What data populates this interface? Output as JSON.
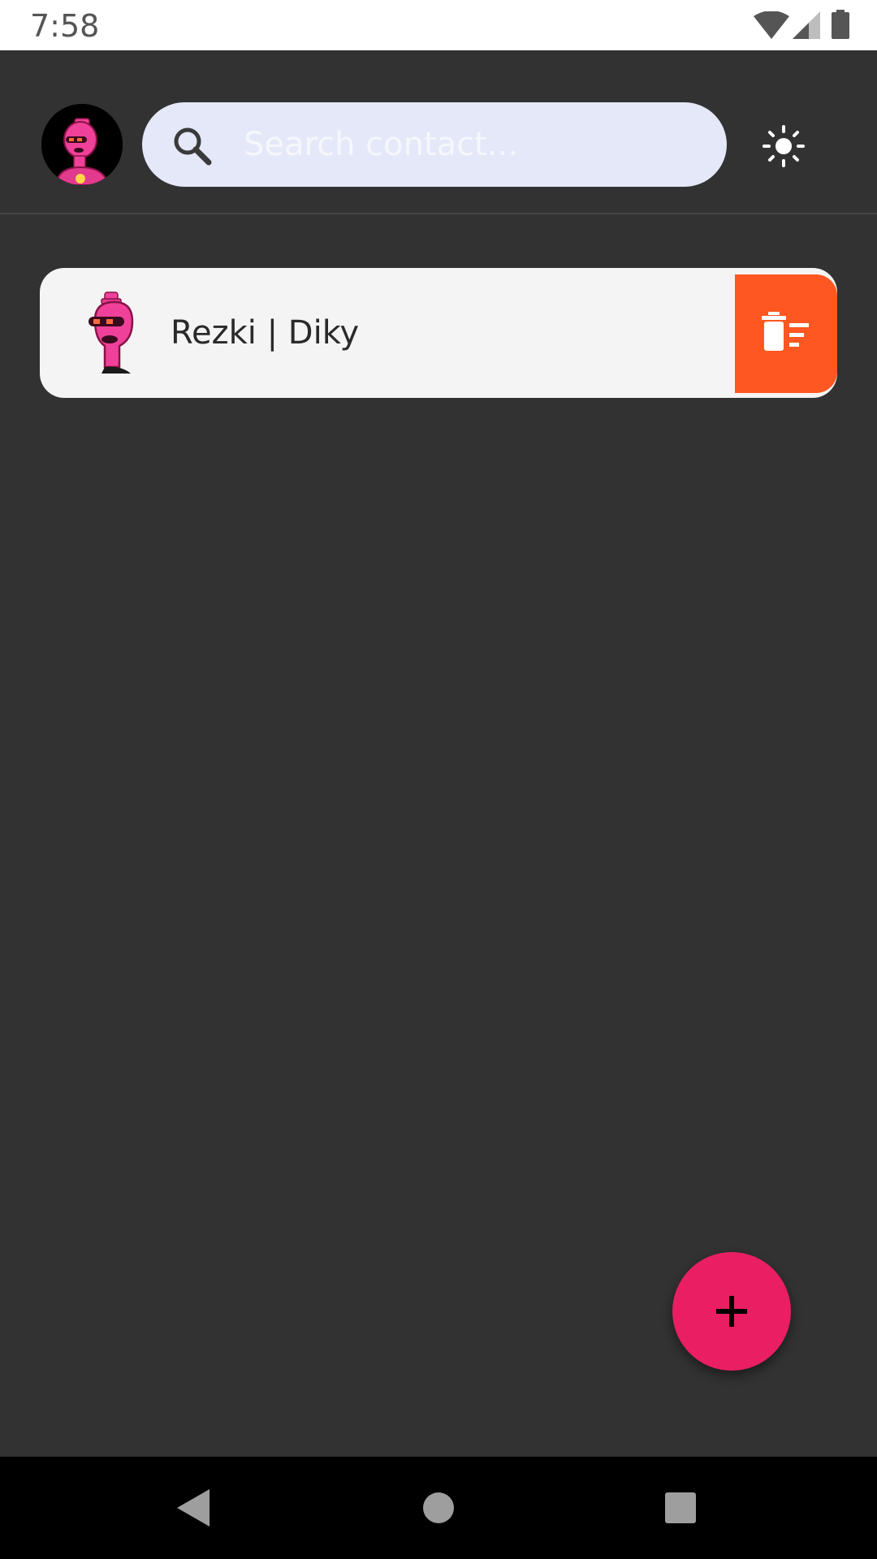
{
  "status_bar": {
    "time": "7:58",
    "icons": [
      "wifi-icon",
      "cell-signal-icon",
      "battery-icon"
    ]
  },
  "header": {
    "avatar_icon": "robot-avatar-icon",
    "search": {
      "placeholder": "Search contact...",
      "value": "",
      "icon": "search-icon"
    },
    "theme_toggle_icon": "sun-icon"
  },
  "contacts": [
    {
      "name": "Rezki | Diky",
      "avatar_icon": "robot-avatar-icon",
      "delete_icon": "delete-sweep-icon"
    }
  ],
  "fab": {
    "icon": "plus-icon"
  },
  "nav_bar": {
    "buttons": [
      "back-icon",
      "home-icon",
      "recents-icon"
    ]
  },
  "colors": {
    "background": "#323232",
    "search_bg": "#e4e8f8",
    "card_bg": "#f4f4f4",
    "delete_accent": "#ff5722",
    "fab_accent": "#e91e63",
    "avatar_pink": "#f0419a"
  }
}
